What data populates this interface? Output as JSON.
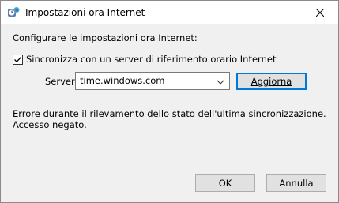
{
  "window": {
    "title": "Impostazioni ora Internet",
    "icon": "clock-globe-icon",
    "close_icon": "close-icon"
  },
  "main": {
    "heading": "Configurare le impostazioni ora Internet:",
    "sync_checkbox": {
      "label": "Sincronizza con un server di riferimento orario Internet",
      "checked": true
    },
    "server": {
      "label": "Server:",
      "value": "time.windows.com"
    },
    "update_button": "Aggiorna",
    "error_message": "Errore durante il rilevamento dello stato dell'ultima sincronizzazione.\nAccesso negato."
  },
  "footer": {
    "ok_label": "OK",
    "cancel_label": "Annulla"
  },
  "colors": {
    "accent": "#0078d7",
    "background": "#f0f0f0"
  }
}
